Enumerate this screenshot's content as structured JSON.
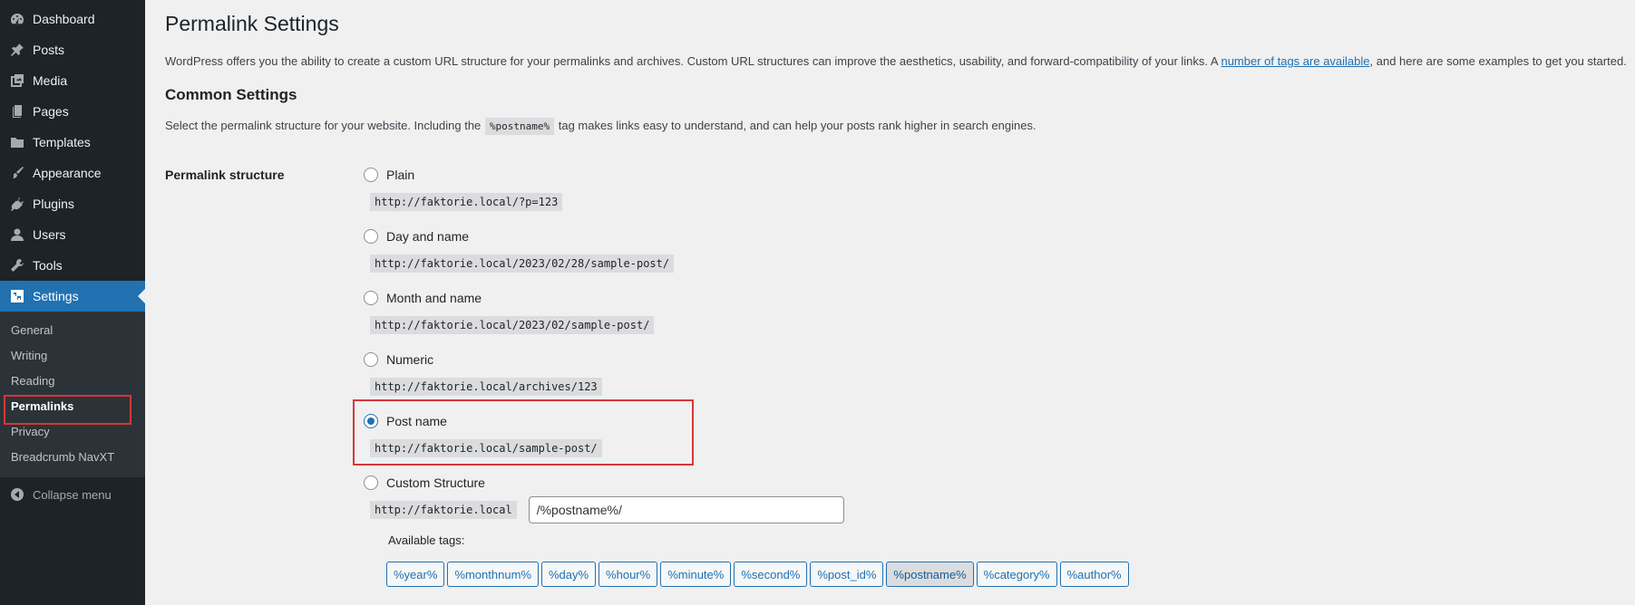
{
  "sidebar": {
    "items": [
      {
        "label": "Dashboard",
        "icon": "dashboard-icon"
      },
      {
        "label": "Posts",
        "icon": "pushpin-icon"
      },
      {
        "label": "Media",
        "icon": "media-icon"
      },
      {
        "label": "Pages",
        "icon": "pages-icon"
      },
      {
        "label": "Templates",
        "icon": "folder-icon"
      },
      {
        "label": "Appearance",
        "icon": "brush-icon"
      },
      {
        "label": "Plugins",
        "icon": "plug-icon"
      },
      {
        "label": "Users",
        "icon": "user-icon"
      },
      {
        "label": "Tools",
        "icon": "wrench-icon"
      },
      {
        "label": "Settings",
        "icon": "settings-icon",
        "current": true
      }
    ],
    "submenu": [
      "General",
      "Writing",
      "Reading",
      "Permalinks",
      "Privacy",
      "Breadcrumb NavXT"
    ],
    "submenu_current": "Permalinks",
    "collapse_label": "Collapse menu"
  },
  "page": {
    "title": "Permalink Settings",
    "intro_before": "WordPress offers you the ability to create a custom URL structure for your permalinks and archives. Custom URL structures can improve the aesthetics, usability, and forward-compatibility of your links. A ",
    "intro_link": "number of tags are available",
    "intro_after": ", and here are some examples to get you started.",
    "common_heading": "Common Settings",
    "desc_before": "Select the permalink structure for your website. Including the ",
    "desc_code": "%postname%",
    "desc_after": " tag makes links easy to understand, and can help your posts rank higher in search engines.",
    "field_label": "Permalink structure"
  },
  "options": [
    {
      "label": "Plain",
      "example": "http://faktorie.local/?p=123",
      "checked": false
    },
    {
      "label": "Day and name",
      "example": "http://faktorie.local/2023/02/28/sample-post/",
      "checked": false
    },
    {
      "label": "Month and name",
      "example": "http://faktorie.local/2023/02/sample-post/",
      "checked": false
    },
    {
      "label": "Numeric",
      "example": "http://faktorie.local/archives/123",
      "checked": false
    },
    {
      "label": "Post name",
      "example": "http://faktorie.local/sample-post/",
      "checked": true
    }
  ],
  "custom": {
    "label": "Custom Structure",
    "base": "http://faktorie.local",
    "value": "/%postname%/",
    "available_label": "Available tags:",
    "tags": [
      "%year%",
      "%monthnum%",
      "%day%",
      "%hour%",
      "%minute%",
      "%second%",
      "%post_id%",
      "%postname%",
      "%category%",
      "%author%"
    ],
    "active_tag": "%postname%"
  },
  "colors": {
    "accent": "#2271b1",
    "sidebar_bg": "#1d2327",
    "highlight_box": "#d63638"
  }
}
